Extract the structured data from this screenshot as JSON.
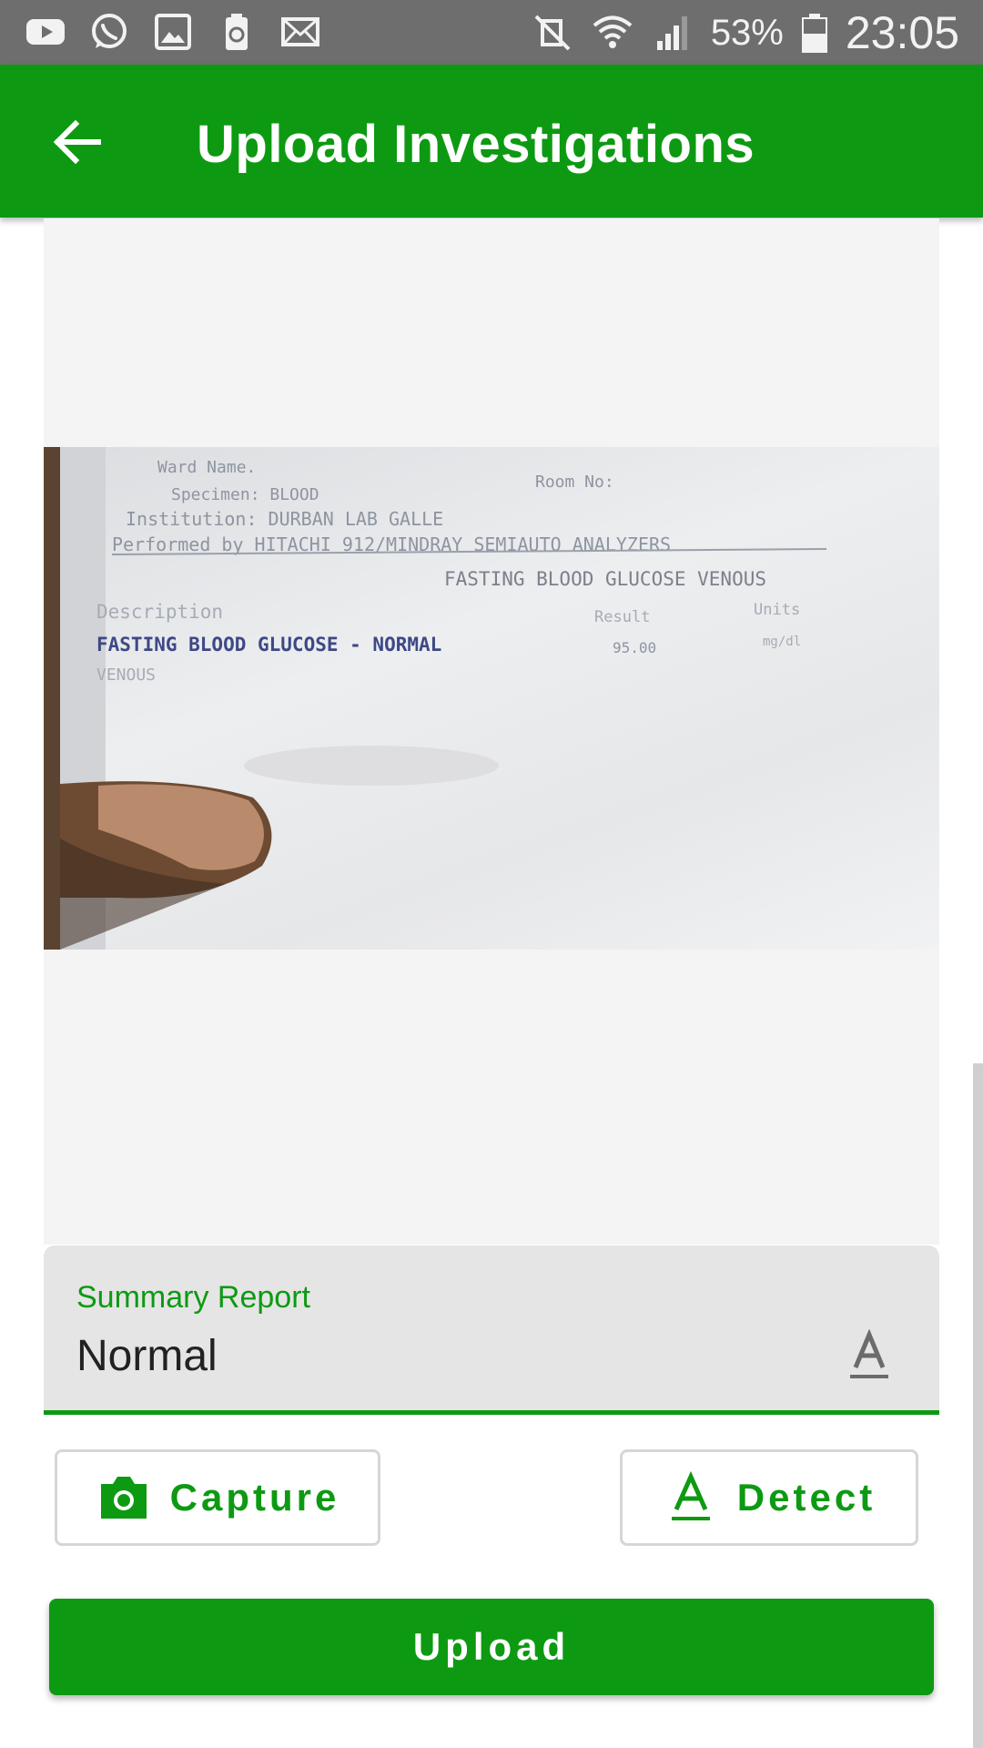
{
  "status_bar": {
    "notification_icons": [
      "youtube-icon",
      "whatsapp-icon",
      "gallery-icon",
      "recycle-icon",
      "mail-icon"
    ],
    "system_icons": [
      "vibrate-off-icon",
      "wifi-icon",
      "signal-icon",
      "battery-icon"
    ],
    "battery_percent": "53%",
    "time": "23:05"
  },
  "app_bar": {
    "title": "Upload Investigations",
    "back_icon": "arrow-back-icon"
  },
  "image_preview": {
    "document_lines": [
      "Ward Name.",
      "Room No:",
      "Specimen: BLOOD",
      "Institution: DURBAN LAB GALLE",
      "Performed by HITACHI 912/MINDRAY SEMIAUTO ANALYZERS",
      "FASTING BLOOD GLUCOSE VENOUS",
      "Description",
      "Result",
      "Units",
      "FASTING BLOOD GLUCOSE - NORMAL",
      "95.00",
      "mg/dl",
      "VENOUS"
    ]
  },
  "summary_field": {
    "label": "Summary Report",
    "value": "Normal",
    "icon": "text-format-icon"
  },
  "buttons": {
    "capture_label": "Capture",
    "capture_icon": "camera-icon",
    "detect_label": "Detect",
    "detect_icon": "text-format-icon",
    "upload_label": "Upload"
  },
  "colors": {
    "primary": "#0d9a12",
    "status_bar": "#6e6e6e",
    "field_bg": "#e5e5e5",
    "image_area_bg": "#f4f4f4"
  }
}
